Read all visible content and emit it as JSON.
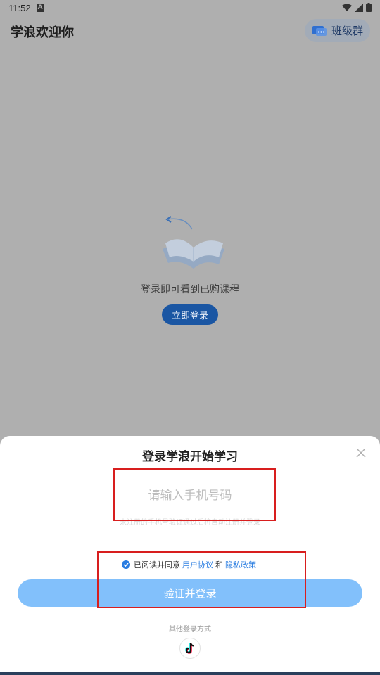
{
  "status_bar": {
    "time": "11:52",
    "notification_badge": "A"
  },
  "header": {
    "title": "学浪欢迎你",
    "class_group_label": "班级群"
  },
  "empty_state": {
    "message": "登录即可看到已购课程",
    "login_button": "立即登录"
  },
  "login_sheet": {
    "title": "登录学浪开始学习",
    "phone_placeholder": "请输入手机号码",
    "phone_value": "",
    "hint": "未注册的手机号验证通过后将自动注册并登录",
    "agreement_prefix": "已阅读并同意",
    "user_agreement": "用户协议",
    "and": "和",
    "privacy_policy": "隐私政策",
    "agreement_checked": true,
    "submit_label": "验证并登录",
    "other_methods": "其他登录方式"
  },
  "colors": {
    "accent": "#2a7de1",
    "submit_bg": "#82c0fb",
    "annotation": "#d81e1e"
  },
  "icons": [
    "wifi-icon",
    "signal-icon",
    "battery-icon",
    "chat-icon",
    "book-icon",
    "close-icon",
    "check-icon",
    "tiktok-icon"
  ]
}
